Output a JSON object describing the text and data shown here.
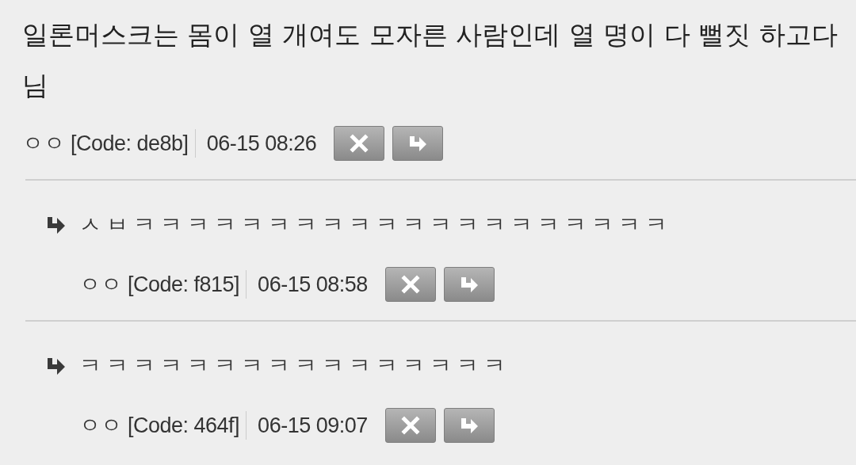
{
  "comment": {
    "text": "일론머스크는 몸이 열 개여도 모자른 사람인데 열 명이 다 뻘짓 하고다님",
    "author": "ㅇㅇ",
    "code": "[Code: de8b]",
    "time": "06-15 08:26"
  },
  "replies": [
    {
      "text": "ㅅㅂㅋㅋㅋㅋㅋㅋㅋㅋㅋㅋㅋㅋㅋㅋㅋㅋㅋㅋㅋㅋ",
      "author": "ㅇㅇ",
      "code": "[Code: f815]",
      "time": "06-15 08:58"
    },
    {
      "text": "ㅋㅋㅋㅋㅋㅋㅋㅋㅋㅋㅋㅋㅋㅋㅋㅋ",
      "author": "ㅇㅇ",
      "code": "[Code: 464f]",
      "time": "06-15 09:07"
    }
  ]
}
